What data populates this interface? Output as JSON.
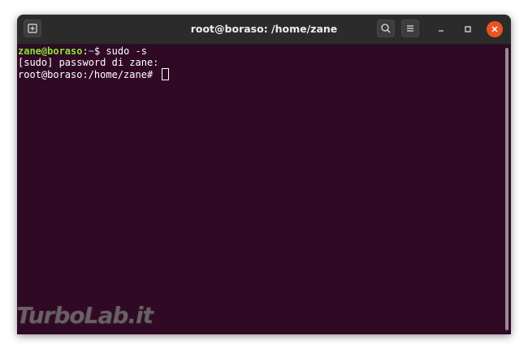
{
  "window": {
    "title": "root@boraso: /home/zane"
  },
  "titlebar": {
    "icons": {
      "new_tab": "new-tab-icon",
      "search": "search-icon",
      "menu": "hamburger-menu-icon",
      "minimize": "minimize-icon",
      "maximize": "maximize-icon",
      "close": "close-icon"
    }
  },
  "terminal": {
    "lines": [
      {
        "user_host": "zane@boraso",
        "colon": ":",
        "cwd": "~",
        "prompt_char": "$ ",
        "command": "sudo -s"
      },
      {
        "text": "[sudo] password di zane:"
      },
      {
        "prompt": "root@boraso:/home/zane# "
      }
    ]
  },
  "watermark": {
    "text": "TurboLab.it"
  },
  "colors": {
    "terminal_bg": "#300a24",
    "titlebar_bg": "#2b2b2b",
    "user_host": "#8ae234",
    "cwd": "#729fcf",
    "close_button": "#e95420",
    "text": "#ffffff"
  }
}
